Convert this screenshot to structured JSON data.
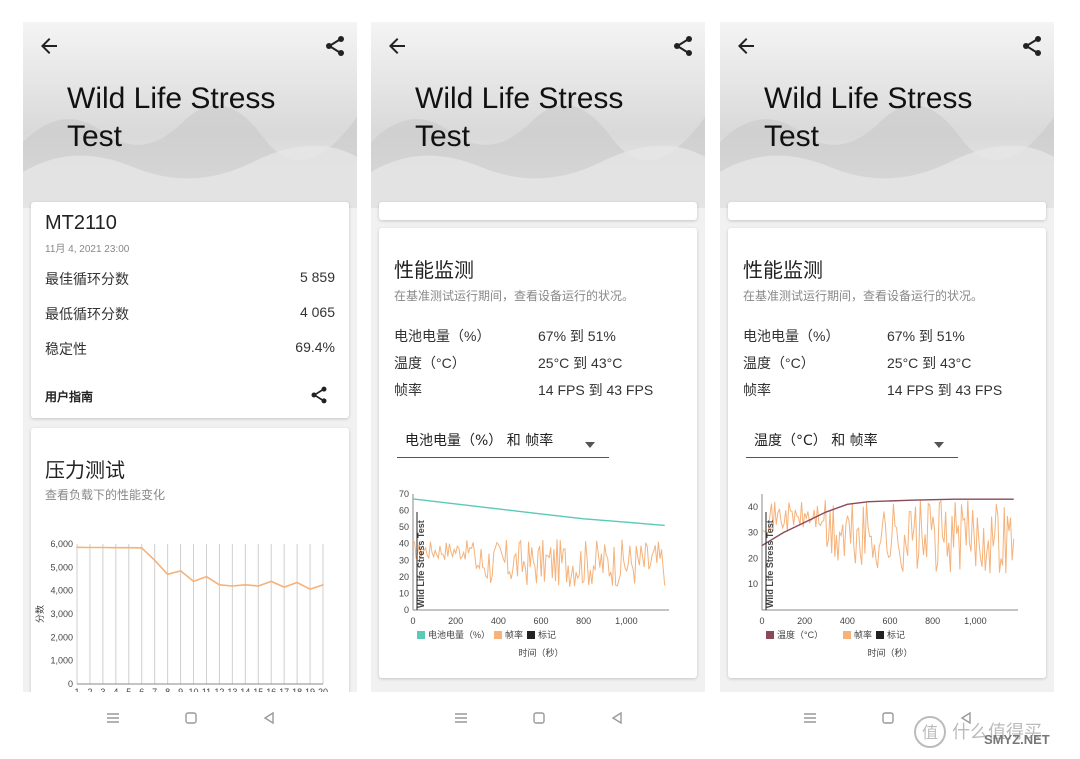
{
  "screens": [
    {
      "hero": {
        "title": "Wild Life Stress Test"
      },
      "device": {
        "name": "MT2110",
        "date": "11月 4, 2021 23:00"
      },
      "stats": [
        {
          "label": "最佳循环分数",
          "value": "5 859"
        },
        {
          "label": "最低循环分数",
          "value": "4 065"
        },
        {
          "label": "稳定性",
          "value": "69.4%"
        }
      ],
      "guide": {
        "label": "用户指南"
      },
      "stress": {
        "title": "压力测试",
        "subtitle": "查看负载下的性能变化",
        "ylabel": "分数"
      }
    },
    {
      "hero": {
        "title": "Wild Life Stress Test"
      },
      "monitor": {
        "title": "性能监测",
        "subtitle": "在基准测试运行期间，查看设备运行的状况。",
        "rows": [
          {
            "label": "电池电量（%）",
            "value": "67% 到 51%"
          },
          {
            "label": "温度（°C）",
            "value": "25°C 到 43°C"
          },
          {
            "label": "帧率",
            "value": "14 FPS 到 43 FPS"
          }
        ],
        "dropdown": "电池电量（%） 和 帧率",
        "legend": [
          "电池电量（%）",
          "帧率",
          "标记"
        ],
        "xlabel": "时间（秒）",
        "marker_label": "Wild Life Stress Test"
      }
    },
    {
      "hero": {
        "title": "Wild Life Stress Test"
      },
      "monitor": {
        "title": "性能监测",
        "subtitle": "在基准测试运行期间，查看设备运行的状况。",
        "rows": [
          {
            "label": "电池电量（%）",
            "value": "67% 到 51%"
          },
          {
            "label": "温度（°C）",
            "value": "25°C 到 43°C"
          },
          {
            "label": "帧率",
            "value": "14 FPS 到 43 FPS"
          }
        ],
        "dropdown": "温度（°C） 和 帧率",
        "legend": [
          "温度（°C）",
          "帧率",
          "标记"
        ],
        "xlabel": "时间（秒）",
        "marker_label": "Wild Life Stress Test"
      }
    }
  ],
  "watermark": {
    "text": "值 什么值得买",
    "site": "SMYZ.NET"
  },
  "colors": {
    "battery": "#5bc8b8",
    "fps": "#f5b27a",
    "temp": "#8a4a5a",
    "marker": "#222222",
    "loop": "#f5b27a"
  },
  "chart_data": [
    {
      "type": "line",
      "ylabel": "分数",
      "x": [
        1,
        2,
        3,
        4,
        5,
        6,
        7,
        8,
        9,
        10,
        11,
        12,
        13,
        14,
        15,
        16,
        17,
        18,
        19,
        20
      ],
      "series": [
        {
          "values": [
            5859,
            5850,
            5850,
            5840,
            5840,
            5830,
            5300,
            4700,
            4850,
            4400,
            4600,
            4250,
            4200,
            4250,
            4200,
            4400,
            4150,
            4350,
            4065,
            4250
          ]
        }
      ],
      "y_ticks": [
        "0",
        "1,000",
        "2,000",
        "3,000",
        "4,000",
        "5,000",
        "6,000"
      ],
      "x_ticks": [
        "1",
        "2",
        "3",
        "4",
        "5",
        "6",
        "7",
        "8",
        "9",
        "10",
        "11",
        "12",
        "13",
        "14",
        "15",
        "16",
        "17",
        "18",
        "19",
        "20"
      ],
      "ylim": [
        0,
        6000
      ],
      "grid": "vertical"
    },
    {
      "type": "line",
      "xlabel": "时间（秒）",
      "x_ticks": [
        "0",
        "200",
        "400",
        "600",
        "800",
        "1,000"
      ],
      "y_ticks": [
        "0",
        "10",
        "20",
        "30",
        "40",
        "50",
        "60",
        "70"
      ],
      "xlim": [
        0,
        1200
      ],
      "ylim": [
        0,
        70
      ],
      "series": [
        {
          "name": "电池电量（%）",
          "points": [
            [
              0,
              67
            ],
            [
              200,
              64
            ],
            [
              400,
              61
            ],
            [
              600,
              58
            ],
            [
              800,
              55
            ],
            [
              1000,
              53
            ],
            [
              1180,
              51
            ]
          ]
        },
        {
          "name": "帧率",
          "range": [
            14,
            43
          ]
        }
      ]
    },
    {
      "type": "line",
      "xlabel": "时间（秒）",
      "x_ticks": [
        "0",
        "200",
        "400",
        "600",
        "800",
        "1,000"
      ],
      "y_ticks": [
        "10",
        "20",
        "30",
        "40"
      ],
      "xlim": [
        0,
        1200
      ],
      "ylim": [
        0,
        45
      ],
      "series": [
        {
          "name": "温度（°C）",
          "points": [
            [
              0,
              25
            ],
            [
              100,
              30
            ],
            [
              200,
              34
            ],
            [
              300,
              38
            ],
            [
              400,
              41
            ],
            [
              500,
              42
            ],
            [
              700,
              42.6
            ],
            [
              900,
              43
            ],
            [
              1180,
              43
            ]
          ]
        },
        {
          "name": "帧率",
          "range": [
            14,
            43
          ]
        }
      ]
    }
  ]
}
